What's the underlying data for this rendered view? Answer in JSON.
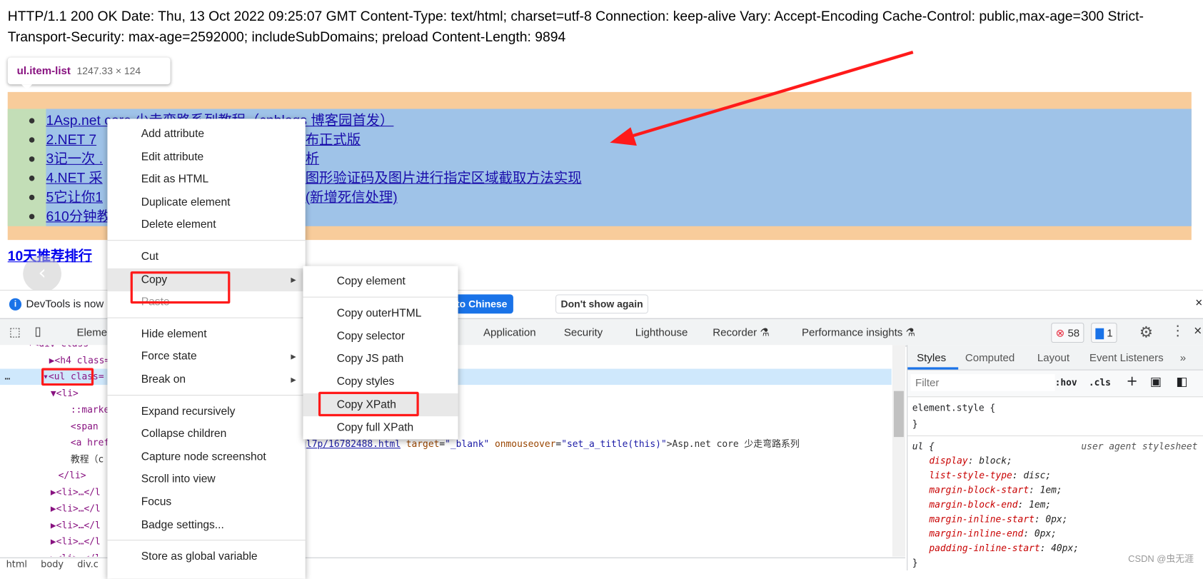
{
  "page": {
    "http_header_text": "HTTP/1.1 200 OK Date: Thu, 13 Oct 2022 09:25:07 GMT Content-Type: text/html; charset=utf-8 Connection: keep-alive Vary: Accept-Encoding Cache-Control: public,max-age=300 Strict-Transport-Security: max-age=2592000; includeSubDomains; preload Content-Length: 9894",
    "inspect_tooltip": {
      "selector": "ul.item-list",
      "size": "1247.33 × 124"
    },
    "list_items": [
      {
        "num": "1",
        "left": "Asp.net core 少走弯路系列教程（cnblogs 博客园首发）",
        "right": ""
      },
      {
        "num": "2",
        "left": ".NET 7 ",
        "right": "布正式版"
      },
      {
        "num": "3",
        "left": "记一次 .",
        "right": "析"
      },
      {
        "num": "4",
        "left": ".NET 采",
        "right": "图形验证码及图片进行指定区域截取方法实现"
      },
      {
        "num": "5",
        "left": "它让你1",
        "right": "(新增死信处理)"
      },
      {
        "num": "6",
        "left": "10分钟教",
        "right": ""
      }
    ],
    "section_heading": "10天推荐排行",
    "back_icon": "chevron-left-icon"
  },
  "devtools": {
    "infobar": {
      "text": "DevTools is now",
      "switch_button": "Switch DevTools to Chinese",
      "dismiss_button": "Don't show again"
    },
    "tabs": [
      "Elements",
      "Application",
      "Security",
      "Lighthouse",
      "Recorder",
      "Performance insights"
    ],
    "errors_count": "58",
    "messages_count": "1",
    "tree_rows": [
      {
        "indent": 36,
        "html": "div",
        "text": "▾<div class="
      },
      {
        "indent": 64,
        "text": "▶<h4 class="
      },
      {
        "indent": 56,
        "text": "▾<ul class="
      },
      {
        "indent": 66,
        "text": "▼<li>"
      },
      {
        "indent": 92,
        "text": "::marker"
      },
      {
        "indent": 92,
        "text": "<span"
      },
      {
        "indent": 92,
        "text": "<a href"
      },
      {
        "indent": 92,
        "text": "教程（c"
      },
      {
        "indent": 76,
        "text": "</li>"
      },
      {
        "indent": 66,
        "text": "▶<li>…</l"
      },
      {
        "indent": 66,
        "text": "▶<li>…</l"
      },
      {
        "indent": 66,
        "text": "▶<li>…</l"
      },
      {
        "indent": 66,
        "text": "▶<li>…</l"
      },
      {
        "indent": 66,
        "text": "▶<li>…</l"
      }
    ],
    "a_row_tail": {
      "href_tail": "ql7p/16782488.html",
      "attr1": "target",
      "val1": "\"_blank\"",
      "attr2": "onmouseover",
      "val2": "\"set_a_title(this)\"",
      "text": ">Asp.net core 少走弯路系列"
    },
    "breadcrumb": [
      "html",
      "body",
      "div.c"
    ],
    "styles": {
      "tabs": [
        "Styles",
        "Computed",
        "Layout",
        "Event Listeners"
      ],
      "filter_placeholder": "Filter",
      "hov": ":hov",
      "cls": ".cls",
      "element_style": "element.style {",
      "close_brace": "}",
      "ul_rule": "ul {",
      "ua_label": "user agent stylesheet",
      "declarations": [
        {
          "prop": "display",
          "value": "block;"
        },
        {
          "prop": "list-style-type",
          "value": "disc;"
        },
        {
          "prop": "margin-block-start",
          "value": "1em;"
        },
        {
          "prop": "margin-block-end",
          "value": "1em;"
        },
        {
          "prop": "margin-inline-start",
          "value": "0px;"
        },
        {
          "prop": "margin-inline-end",
          "value": "0px;"
        },
        {
          "prop": "padding-inline-start",
          "value": "40px;"
        }
      ]
    }
  },
  "context_menu": {
    "items": [
      "Add attribute",
      "Edit attribute",
      "Edit as HTML",
      "Duplicate element",
      "Delete element",
      "Cut",
      "Copy",
      "Paste",
      "Hide element",
      "Force state",
      "Break on",
      "Expand recursively",
      "Collapse children",
      "Capture node screenshot",
      "Scroll into view",
      "Focus",
      "Badge settings...",
      "Store as global variable"
    ],
    "highlighted": "Copy"
  },
  "copy_submenu": {
    "items": [
      "Copy element",
      "Copy outerHTML",
      "Copy selector",
      "Copy JS path",
      "Copy styles",
      "Copy XPath",
      "Copy full XPath"
    ],
    "highlighted": "Copy XPath"
  },
  "watermark": "CSDN @虫无涯",
  "colors": {
    "annotation_red": "#ff1a1a",
    "highlight_blue": "#9fc3e8",
    "margin_orange": "#f8cc9b",
    "padding_green": "#c3deb7",
    "devtools_blue": "#1a73e8"
  }
}
